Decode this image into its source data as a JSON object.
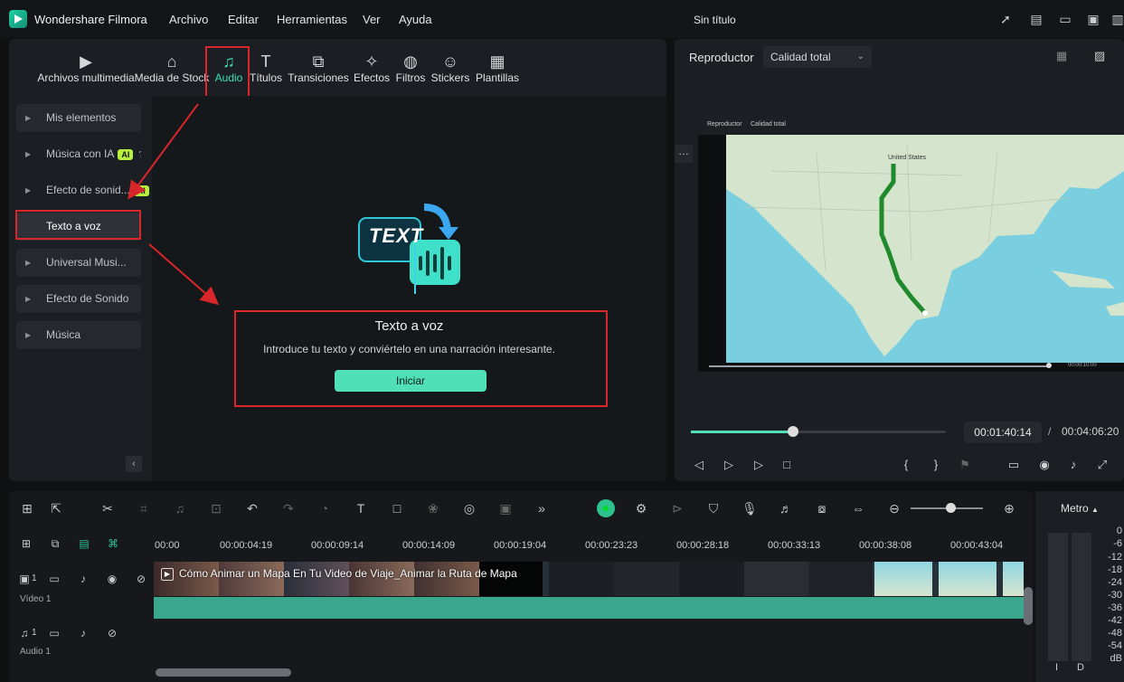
{
  "app": {
    "name": "Wondershare Filmora",
    "doc_title": "Sin título"
  },
  "menu": [
    "Archivo",
    "Editar",
    "Herramientas",
    "Ver",
    "Ayuda"
  ],
  "tabs": [
    {
      "label": "Archivos multimedia",
      "icon": "media-icon"
    },
    {
      "label": "Media de Stock",
      "icon": "stock-icon"
    },
    {
      "label": "Audio",
      "icon": "music-note-icon",
      "active": true
    },
    {
      "label": "Títulos",
      "icon": "title-text-icon"
    },
    {
      "label": "Transiciones",
      "icon": "transition-icon"
    },
    {
      "label": "Efectos",
      "icon": "effects-icon"
    },
    {
      "label": "Filtros",
      "icon": "filters-icon"
    },
    {
      "label": "Stickers",
      "icon": "sticker-icon"
    },
    {
      "label": "Plantillas",
      "icon": "templates-icon"
    }
  ],
  "sidebar": {
    "items": [
      {
        "label": "Mis elementos"
      },
      {
        "label": "Música con IA",
        "badge": "AI"
      },
      {
        "label": "Efecto de sonid...",
        "badge": "AI"
      },
      {
        "label": "Texto a voz",
        "selected": true
      },
      {
        "label": "Universal Musi..."
      },
      {
        "label": "Efecto de Sonido"
      },
      {
        "label": "Música"
      }
    ]
  },
  "tts": {
    "graphic_text": "TEXT",
    "title": "Texto a voz",
    "description": "Introduce tu texto y conviértelo en una narración interesante.",
    "button": "Iniciar"
  },
  "player": {
    "label": "Reproductor",
    "quality": "Calidad total",
    "inner_label": "Reproductor",
    "inner_quality": "Calidad total",
    "inner_time": "00:00:10:00",
    "map_label": "United States",
    "current_time": "00:01:40:14",
    "separator": "/",
    "total_time": "00:04:06:20",
    "progress": 0.4
  },
  "timeline": {
    "ruler": [
      "00:00",
      "00:00:04:19",
      "00:00:09:14",
      "00:00:14:09",
      "00:00:19:04",
      "00:00:23:23",
      "00:00:28:18",
      "00:00:33:13",
      "00:00:38:08",
      "00:00:43:04"
    ],
    "video_track": {
      "number": "1",
      "label": "Vídeo 1"
    },
    "audio_track": {
      "number": "1",
      "label": "Audio 1"
    },
    "clip_title": "Cómo Animar un Mapa En Tu Video de Viaje_Animar la Ruta de Mapa"
  },
  "meter": {
    "title": "Metro",
    "scale": [
      "0",
      "-6",
      "-12",
      "-18",
      "-24",
      "-30",
      "-36",
      "-42",
      "-48",
      "-54",
      "dB"
    ],
    "channels": [
      "I",
      "D"
    ]
  },
  "colors": {
    "accent": "#4fe0b8",
    "annotation": "#d8262a"
  }
}
